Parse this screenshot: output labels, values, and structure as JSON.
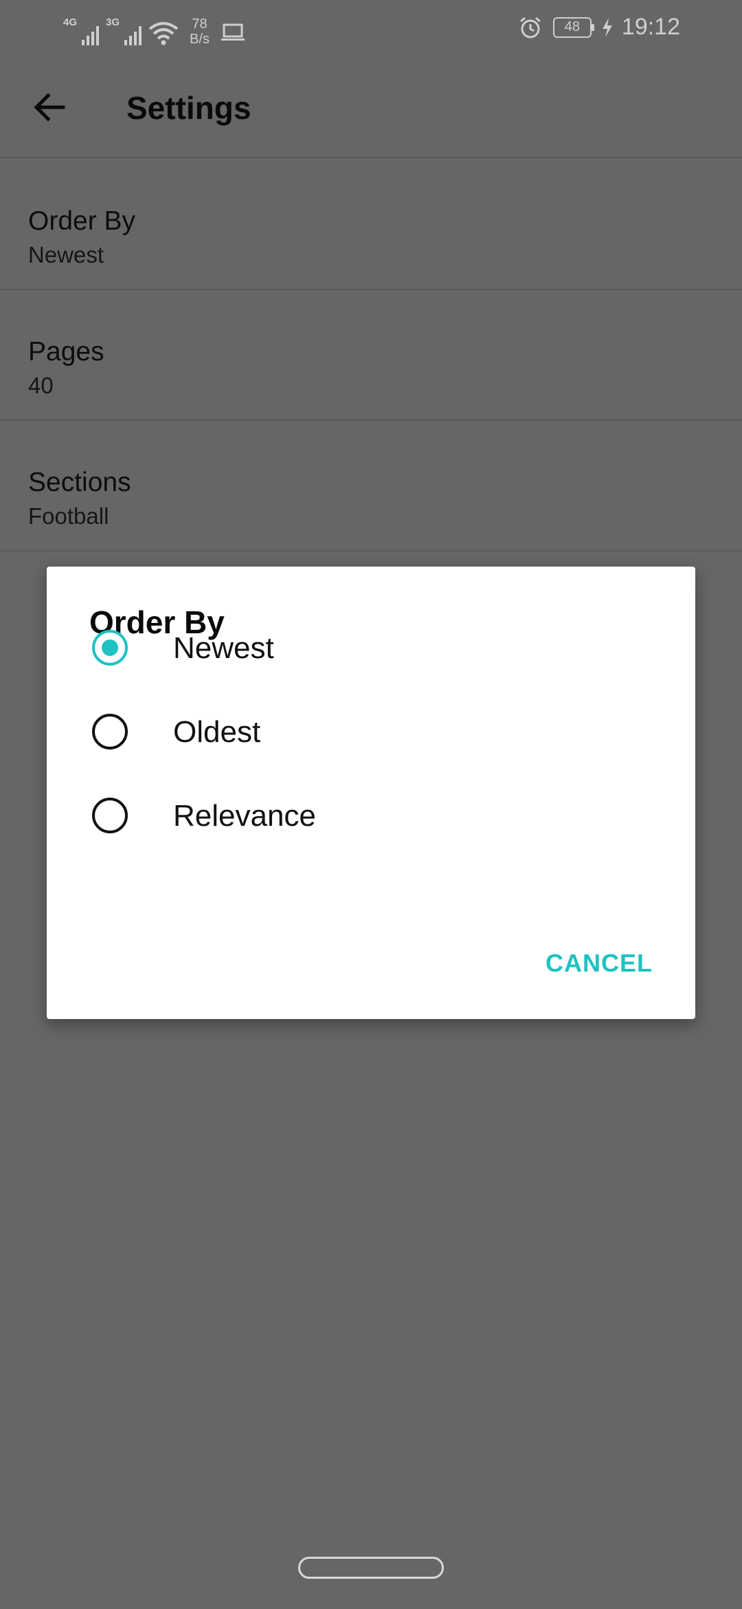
{
  "status_bar": {
    "signal1_tag": "4G",
    "signal2_tag": "3G",
    "speed_value": "78",
    "speed_unit": "B/s",
    "battery": "48",
    "time": "19:12",
    "icons": [
      "signal-icon",
      "wifi-icon",
      "laptop-icon",
      "alarm-icon",
      "battery-icon",
      "charging-icon"
    ]
  },
  "app_bar": {
    "title": "Settings",
    "back_icon": "arrow-back-icon"
  },
  "preferences": [
    {
      "title": "Order By",
      "summary": "Newest"
    },
    {
      "title": "Pages",
      "summary": "40"
    },
    {
      "title": "Sections",
      "summary": "Football"
    }
  ],
  "dialog": {
    "title": "Order By",
    "options": [
      {
        "label": "Newest",
        "selected": true
      },
      {
        "label": "Oldest",
        "selected": false
      },
      {
        "label": "Relevance",
        "selected": false
      }
    ],
    "cancel_label": "CANCEL"
  },
  "colors": {
    "accent": "#1fc1c3",
    "scrim_background": "#666666",
    "dialog_background": "#ffffff"
  }
}
